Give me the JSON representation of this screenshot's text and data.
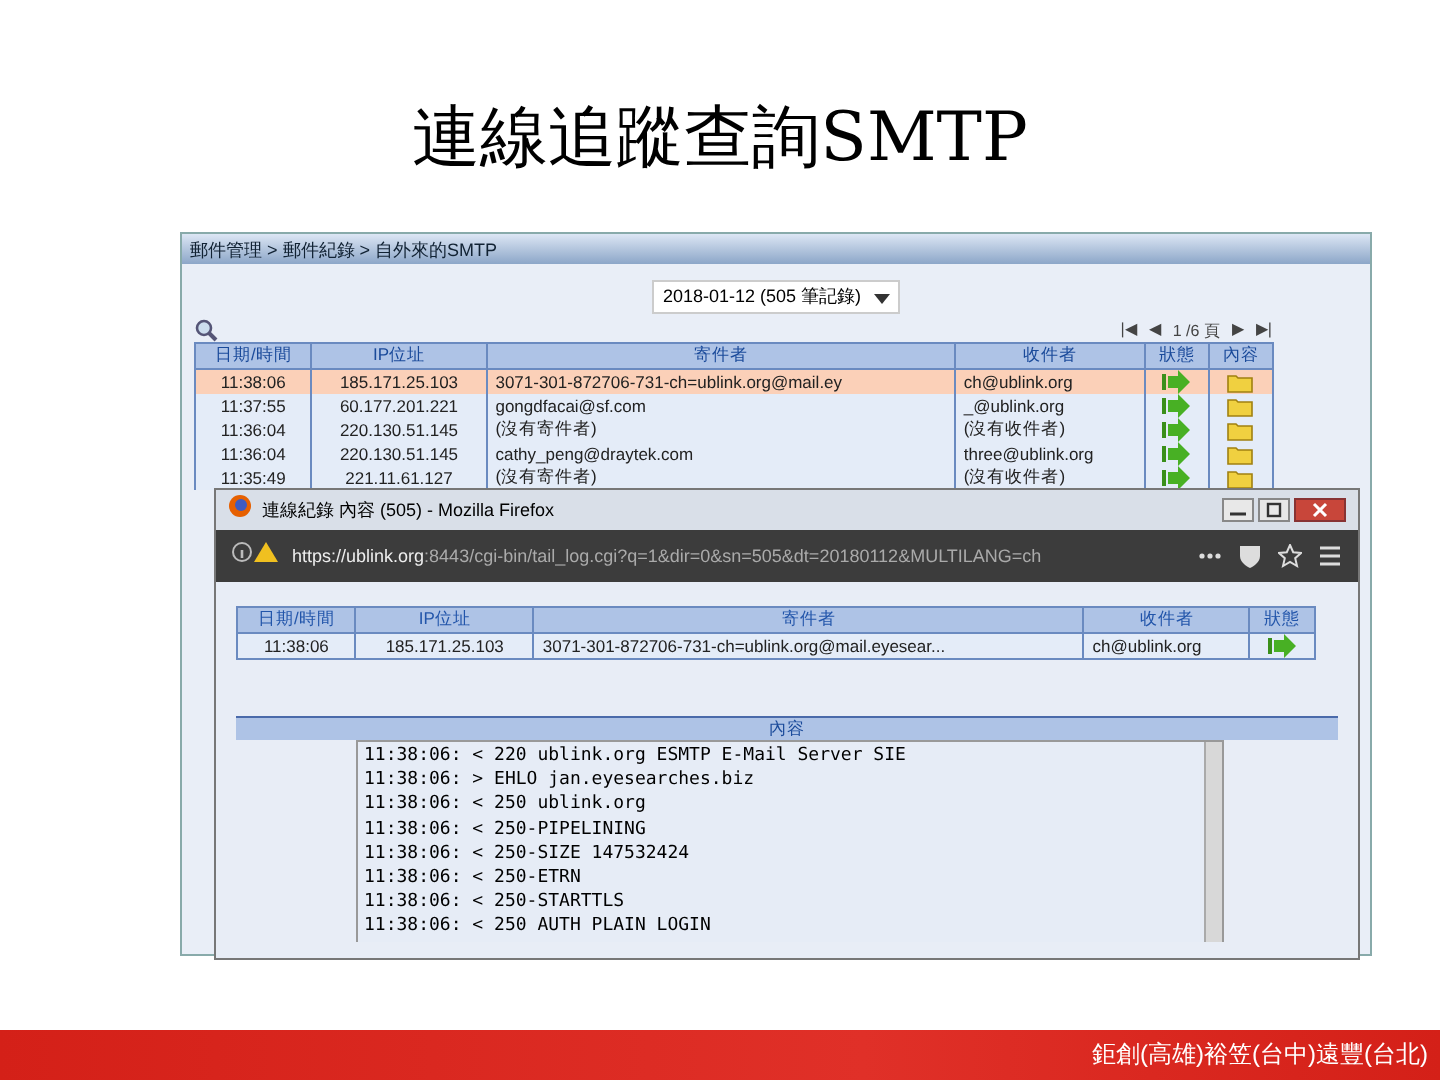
{
  "slide_title": "連線追蹤查詢SMTP",
  "back_window": {
    "breadcrumb": "郵件管理 > 郵件紀錄 > 自外來的SMTP",
    "date_select": "2018-01-12 (505 筆記錄)",
    "pager": [
      "|◀",
      "◀",
      "1 /6 頁",
      "▶",
      "▶|"
    ],
    "columns": [
      "日期/時間",
      "IP位址",
      "寄件者",
      "收件者",
      "狀態",
      "內容"
    ],
    "rows": [
      {
        "time": "11:38:06",
        "ip": "185.171.25.103",
        "sender": "3071-301-872706-731-ch=ublink.org@mail.ey",
        "recipient": "ch@ublink.org",
        "selected": true
      },
      {
        "time": "11:37:55",
        "ip": "60.177.201.221",
        "sender": "gongdfacai@sf.com",
        "recipient": "_@ublink.org",
        "selected": false
      },
      {
        "time": "11:36:04",
        "ip": "220.130.51.145",
        "sender": "(沒有寄件者)",
        "recipient": "(沒有收件者)",
        "selected": false
      },
      {
        "time": "11:36:04",
        "ip": "220.130.51.145",
        "sender": "cathy_peng@draytek.com",
        "recipient": "three@ublink.org",
        "selected": false
      },
      {
        "time": "11:35:49",
        "ip": "221.11.61.127",
        "sender": "(沒有寄件者)",
        "recipient": "(沒有收件者)",
        "selected": false
      }
    ]
  },
  "front_window": {
    "title": "連線紀錄 內容 (505) - Mozilla Firefox",
    "url_host": "https://ublink.org",
    "url_rest": ":8443/cgi-bin/tail_log.cgi?q=1&dir=0&sn=505&dt=20180112&MULTILANG=ch",
    "columns": [
      "日期/時間",
      "IP位址",
      "寄件者",
      "收件者",
      "狀態"
    ],
    "rows": [
      {
        "time": "11:38:06",
        "ip": "185.171.25.103",
        "sender": "3071-301-872706-731-ch=ublink.org@mail.eyesear...",
        "recipient": "ch@ublink.org"
      }
    ],
    "content_header": "內容",
    "log_lines": [
      "11:38:06: < 220 ublink.org ESMTP E-Mail Server SIE",
      "11:38:06: > EHLO jan.eyesearches.biz",
      "11:38:06: < 250 ublink.org",
      "11:38:06: < 250-PIPELINING",
      "11:38:06: < 250-SIZE 147532424",
      "11:38:06: < 250-ETRN",
      "11:38:06: < 250-STARTTLS",
      "11:38:06: < 250 AUTH PLAIN LOGIN"
    ]
  },
  "footer": "鉅創(高雄)裕笠(台中)遠豐(台北)"
}
